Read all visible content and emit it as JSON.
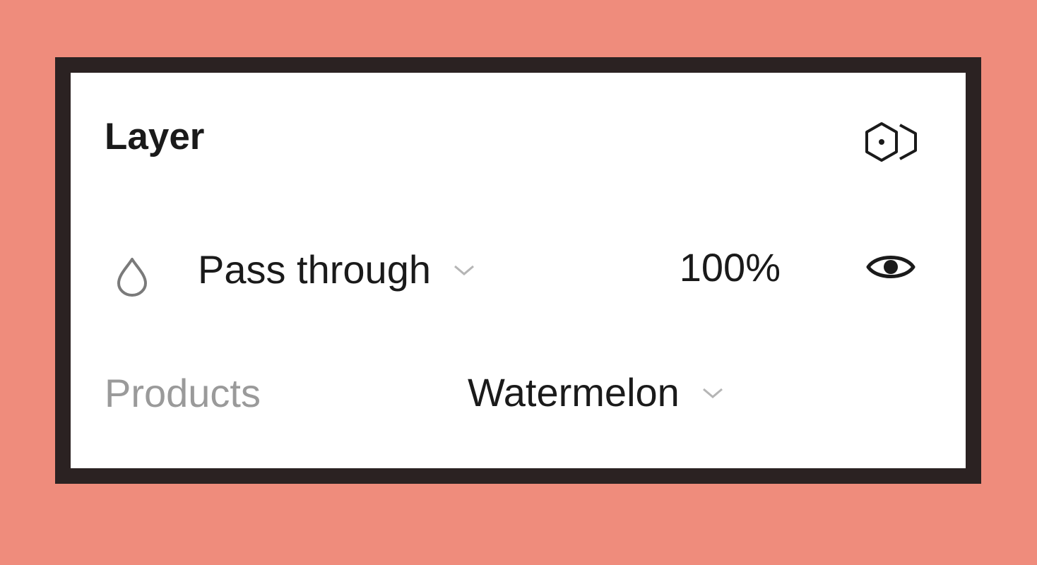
{
  "panel": {
    "title": "Layer",
    "layer_icon": "component-instance-icon",
    "blend": {
      "icon": "blend-mode-drop-icon",
      "label": "Pass through",
      "chevron": "chevron-down-icon"
    },
    "opacity": "100%",
    "visibility_icon": "eye-icon",
    "property": {
      "label": "Products",
      "value": "Watermelon",
      "chevron": "chevron-down-icon"
    }
  },
  "colors": {
    "background": "#ef8c7c",
    "frame": "#2b2222",
    "panel": "#ffffff",
    "text": "#1a1a1a",
    "muted": "#9a9a9a"
  }
}
